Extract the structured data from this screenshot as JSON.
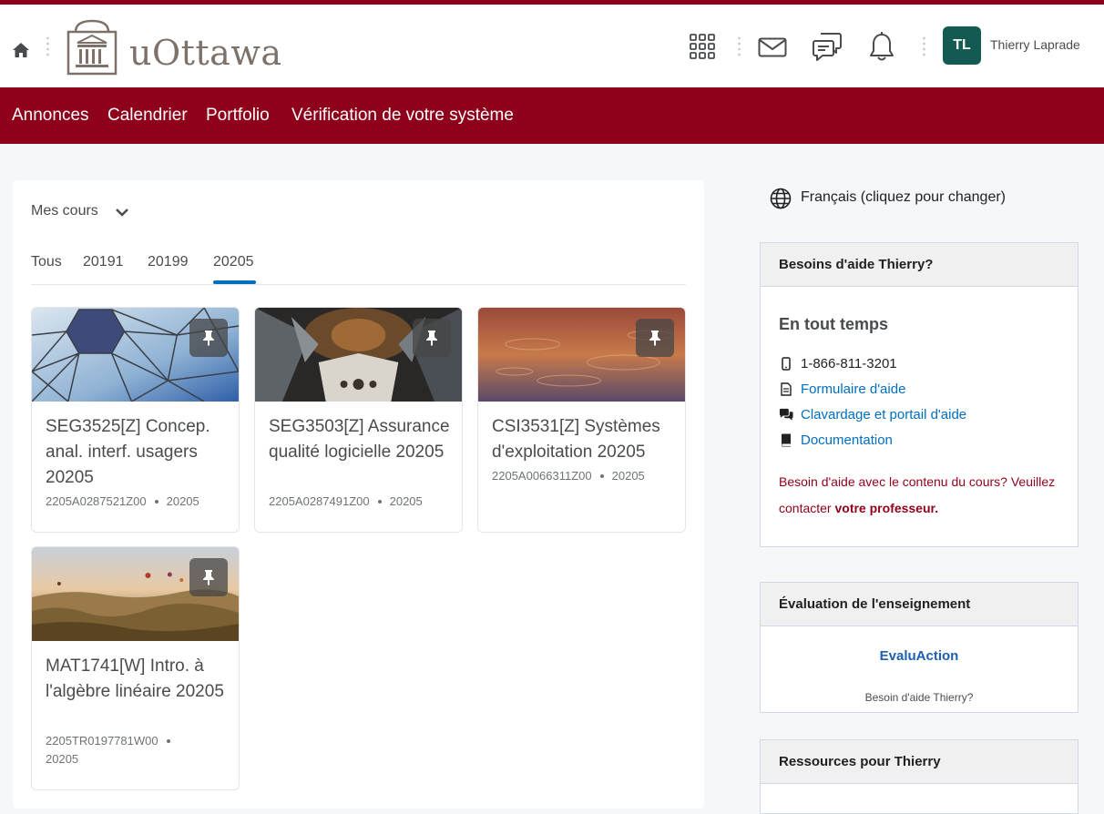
{
  "header": {
    "logo_text": "uOttawa",
    "user_initials": "TL",
    "user_name": "Thierry Laprade"
  },
  "nav": {
    "items": [
      {
        "label": "Annonces"
      },
      {
        "label": "Calendrier"
      },
      {
        "label": "Portfolio"
      },
      {
        "label": "Vérification de votre système"
      }
    ]
  },
  "courses_widget": {
    "title": "Mes cours",
    "tabs": [
      "Tous",
      "20191",
      "20199",
      "20205"
    ],
    "selected_tab": "20205",
    "courses": [
      {
        "title": "SEG3525[Z] Concep. anal. interf. usagers 20205",
        "code": "2205A0287521Z00",
        "term": "20205",
        "image": "geodesic-dome"
      },
      {
        "title": "SEG3503[Z] Assurance qualité logicielle 20205",
        "code": "2205A0287491Z00",
        "term": "20205",
        "image": "cathedral-columns"
      },
      {
        "title": "CSI3531[Z] Systèmes d'exploitation 20205",
        "code": "2205A0066311Z00",
        "term": "20205",
        "image": "water-reflection"
      },
      {
        "title": "MAT1741[W] Intro. à l'algèbre linéaire 20205",
        "code": "2205TR0197781W00",
        "term": "20205",
        "image": "hot-air-balloons"
      }
    ]
  },
  "language": {
    "label": "Français (cliquez pour changer)"
  },
  "help_widget": {
    "title": "Besoins d'aide Thierry?",
    "subtitle": "En tout temps",
    "phone": "1-866-811-3201",
    "form_link": "Formulaire d'aide",
    "chat_link": "Clavardage et portail d'aide",
    "doc_link": "Documentation",
    "note_prefix": "Besoin d'aide avec le contenu du cours? Veuillez contacter ",
    "note_bold": "votre professeur."
  },
  "eval_widget": {
    "title": "Évaluation de l'enseignement",
    "link": "EvaluAction",
    "sub": "Besoin d'aide Thierry?"
  },
  "resources_widget": {
    "title": "Ressources pour Thierry"
  },
  "colors": {
    "brand": "#8f001a",
    "link": "#006fbf",
    "avatar": "#125a52"
  }
}
